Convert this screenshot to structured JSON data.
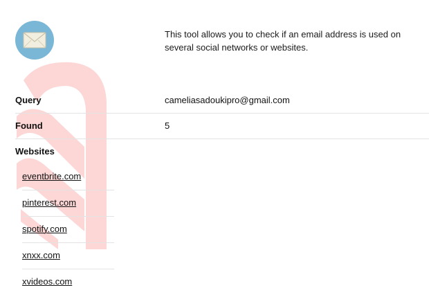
{
  "intro": {
    "icon": "envelope-icon",
    "text": "This tool allows you to check if an email address is used on several social networks or websites."
  },
  "results": {
    "query_label": "Query",
    "query_value": "cameliasadoukipro@gmail.com",
    "found_label": "Found",
    "found_value": "5",
    "websites_label": "Websites",
    "websites": [
      "eventbrite.com",
      "pinterest.com",
      "spotify.com",
      "xnxx.com",
      "xvideos.com"
    ]
  },
  "colors": {
    "icon_circle": "#7ab6d6",
    "envelope": "#f3efe0",
    "watermark": "#fdd6d6",
    "divider": "#e3e3e3"
  }
}
